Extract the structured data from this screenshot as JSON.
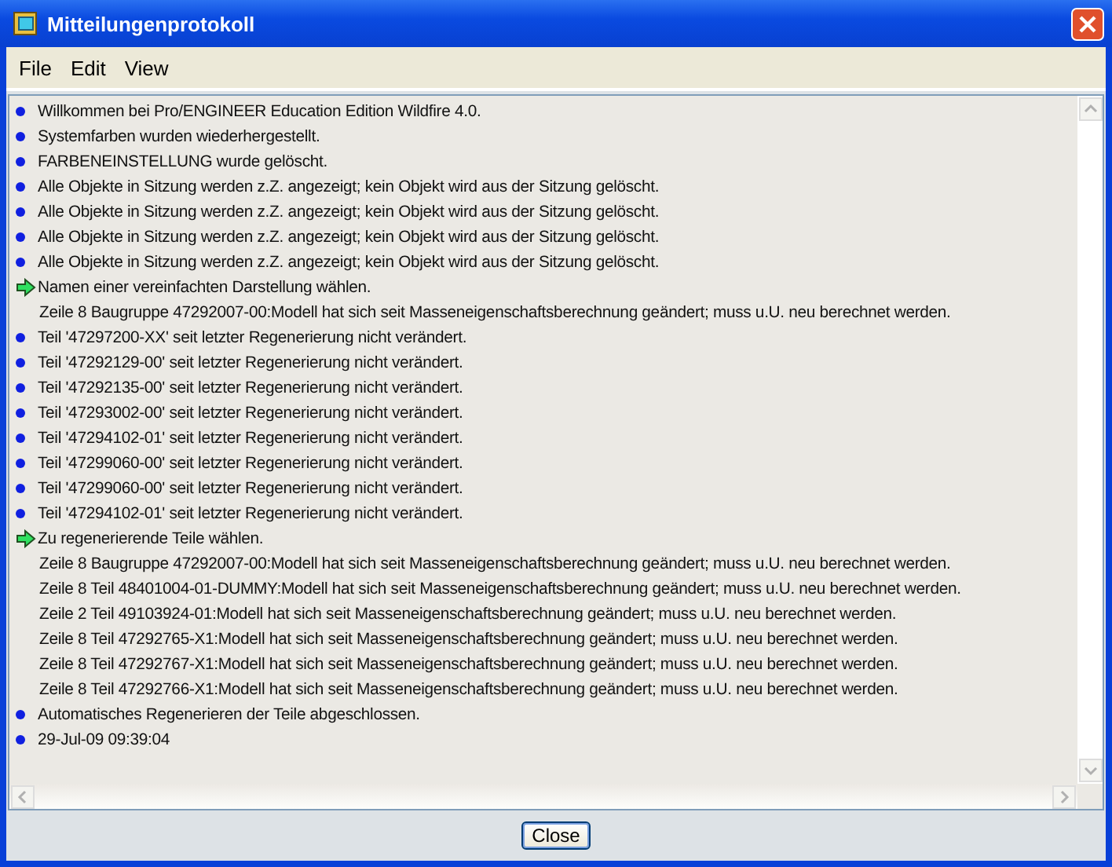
{
  "window": {
    "title": "Mitteilungenprotokoll"
  },
  "menu": [
    "File",
    "Edit",
    "View"
  ],
  "messages": [
    {
      "kind": "info",
      "text": "Willkommen bei Pro/ENGINEER Education Edition Wildfire 4.0."
    },
    {
      "kind": "info",
      "text": "Systemfarben wurden wiederhergestellt."
    },
    {
      "kind": "info",
      "text": "FARBENEINSTELLUNG wurde gelöscht."
    },
    {
      "kind": "info",
      "text": "Alle Objekte in Sitzung werden z.Z. angezeigt; kein Objekt wird aus der Sitzung gelöscht."
    },
    {
      "kind": "info",
      "text": "Alle Objekte in Sitzung werden z.Z. angezeigt; kein Objekt wird aus der Sitzung gelöscht."
    },
    {
      "kind": "info",
      "text": "Alle Objekte in Sitzung werden z.Z. angezeigt; kein Objekt wird aus der Sitzung gelöscht."
    },
    {
      "kind": "info",
      "text": "Alle Objekte in Sitzung werden z.Z. angezeigt; kein Objekt wird aus der Sitzung gelöscht."
    },
    {
      "kind": "prompt",
      "text": "Namen einer vereinfachten Darstellung wählen."
    },
    {
      "kind": "detail",
      "text": "Zeile 8 Baugruppe 47292007-00:Modell hat sich seit Masseneigenschaftsberechnung geändert; muss u.U. neu berechnet werden."
    },
    {
      "kind": "info",
      "text": "Teil '47297200-XX' seit letzter Regenerierung nicht verändert."
    },
    {
      "kind": "info",
      "text": "Teil '47292129-00' seit letzter Regenerierung nicht verändert."
    },
    {
      "kind": "info",
      "text": "Teil '47292135-00' seit letzter Regenerierung nicht verändert."
    },
    {
      "kind": "info",
      "text": "Teil '47293002-00' seit letzter Regenerierung nicht verändert."
    },
    {
      "kind": "info",
      "text": "Teil '47294102-01' seit letzter Regenerierung nicht verändert."
    },
    {
      "kind": "info",
      "text": "Teil '47299060-00' seit letzter Regenerierung nicht verändert."
    },
    {
      "kind": "info",
      "text": "Teil '47299060-00' seit letzter Regenerierung nicht verändert."
    },
    {
      "kind": "info",
      "text": "Teil '47294102-01' seit letzter Regenerierung nicht verändert."
    },
    {
      "kind": "prompt",
      "text": "Zu regenerierende Teile wählen."
    },
    {
      "kind": "detail",
      "text": "Zeile 8 Baugruppe 47292007-00:Modell hat sich seit Masseneigenschaftsberechnung geändert; muss u.U. neu berechnet werden."
    },
    {
      "kind": "detail",
      "text": "Zeile 8 Teil 48401004-01-DUMMY:Modell hat sich seit Masseneigenschaftsberechnung geändert; muss u.U. neu berechnet werden."
    },
    {
      "kind": "detail",
      "text": "Zeile 2 Teil 49103924-01:Modell hat sich seit Masseneigenschaftsberechnung geändert; muss u.U. neu berechnet werden."
    },
    {
      "kind": "detail",
      "text": "Zeile 8 Teil 47292765-X1:Modell hat sich seit Masseneigenschaftsberechnung geändert; muss u.U. neu berechnet werden."
    },
    {
      "kind": "detail",
      "text": "Zeile 8 Teil 47292767-X1:Modell hat sich seit Masseneigenschaftsberechnung geändert; muss u.U. neu berechnet werden."
    },
    {
      "kind": "detail",
      "text": "Zeile 8 Teil 47292766-X1:Modell hat sich seit Masseneigenschaftsberechnung geändert; muss u.U. neu berechnet werden."
    },
    {
      "kind": "info",
      "text": "Automatisches Regenerieren der Teile abgeschlossen."
    },
    {
      "kind": "info",
      "text": "29-Jul-09 09:39:04"
    }
  ],
  "buttons": [
    "Close"
  ]
}
